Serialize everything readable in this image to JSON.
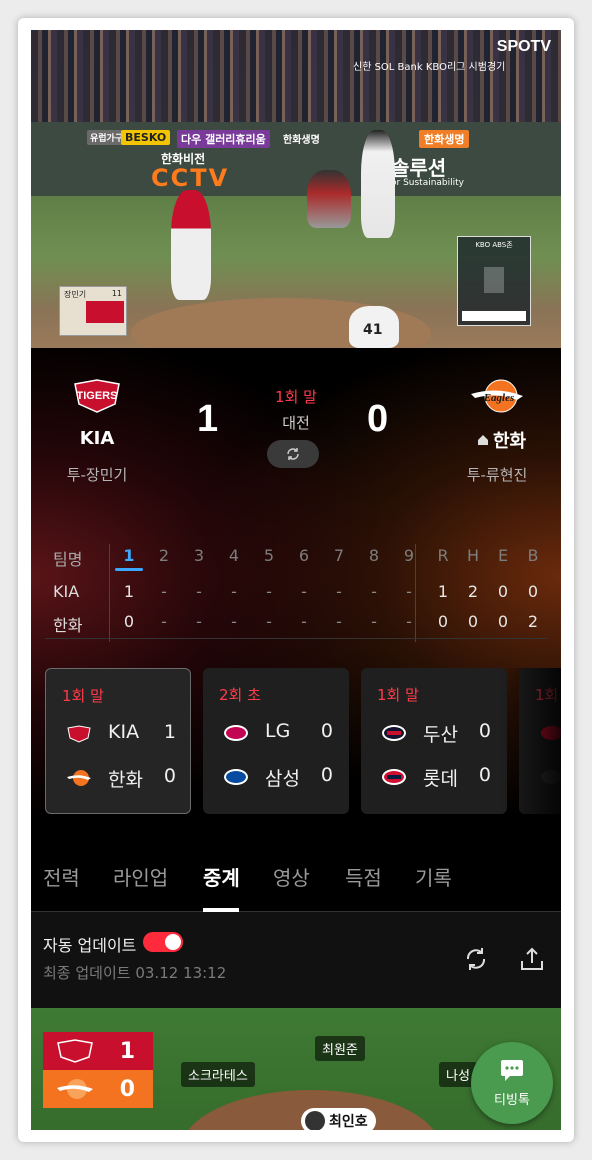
{
  "video": {
    "broadcaster": "SPOTV",
    "ad_top": "신한 SOL Bank KBO리그 시범경기",
    "banners": [
      "유럽가구",
      "BESKO",
      "다우 갤러리휴리움",
      "한화생명",
      "한화생명",
      "한화비전",
      "CCTV",
      "솔루션",
      "or Sustainability"
    ],
    "overlay_player": "장민기",
    "overlay_count": "11",
    "kbo_box_label": "KBO ABS존",
    "jersey_number": "41"
  },
  "game": {
    "away": {
      "name": "KIA",
      "pitcher": "투-장민기",
      "score": "1",
      "logo_text": "TIGERS"
    },
    "home": {
      "name": "한화",
      "pitcher": "투-류현진",
      "score": "0",
      "logo_text": "Eagles"
    },
    "inning": "1회 말",
    "stadium": "대전"
  },
  "linescore": {
    "team_header": "팀명",
    "innings": [
      "1",
      "2",
      "3",
      "4",
      "5",
      "6",
      "7",
      "8",
      "9"
    ],
    "totals_headers": [
      "R",
      "H",
      "E",
      "B"
    ],
    "rows": [
      {
        "team": "KIA",
        "innings": [
          "1",
          "-",
          "-",
          "-",
          "-",
          "-",
          "-",
          "-",
          "-"
        ],
        "totals": [
          "1",
          "2",
          "0",
          "0"
        ]
      },
      {
        "team": "한화",
        "innings": [
          "0",
          "-",
          "-",
          "-",
          "-",
          "-",
          "-",
          "-",
          "-"
        ],
        "totals": [
          "0",
          "0",
          "0",
          "2"
        ]
      }
    ]
  },
  "other_games": [
    {
      "inning": "1회 말",
      "away": "KIA",
      "away_score": "1",
      "home": "한화",
      "home_score": "0",
      "away_color": "#c8102e",
      "home_color": "#f37321"
    },
    {
      "inning": "2회 초",
      "away": "LG",
      "away_score": "0",
      "home": "삼성",
      "home_score": "0",
      "away_color": "#c30452",
      "home_color": "#074ca1"
    },
    {
      "inning": "1회 말",
      "away": "두산",
      "away_score": "0",
      "home": "롯데",
      "home_score": "0",
      "away_color": "#131230",
      "home_color": "#d00f31"
    },
    {
      "inning": "1회",
      "away": "",
      "away_score": "",
      "home": "",
      "home_score": "",
      "away_color": "#c8102e",
      "home_color": "#333333"
    }
  ],
  "tabs": [
    "전력",
    "라인업",
    "중계",
    "영상",
    "득점",
    "기록"
  ],
  "active_tab": "중계",
  "auto_update": {
    "label": "자동 업데이트",
    "enabled": true,
    "last_update": "최종 업데이트 03.12 13:12"
  },
  "field": {
    "mini_score_away": "1",
    "mini_score_home": "0",
    "fielders": [
      "최원준",
      "소크라테스",
      "나성"
    ],
    "batter": "최인호"
  },
  "fab": {
    "label": "티빙톡",
    "icon": "chat-icon"
  },
  "colors": {
    "accent_red": "#ff3b4a",
    "accent_blue": "#3aa8ff",
    "tving_green": "#4a9a4f"
  }
}
